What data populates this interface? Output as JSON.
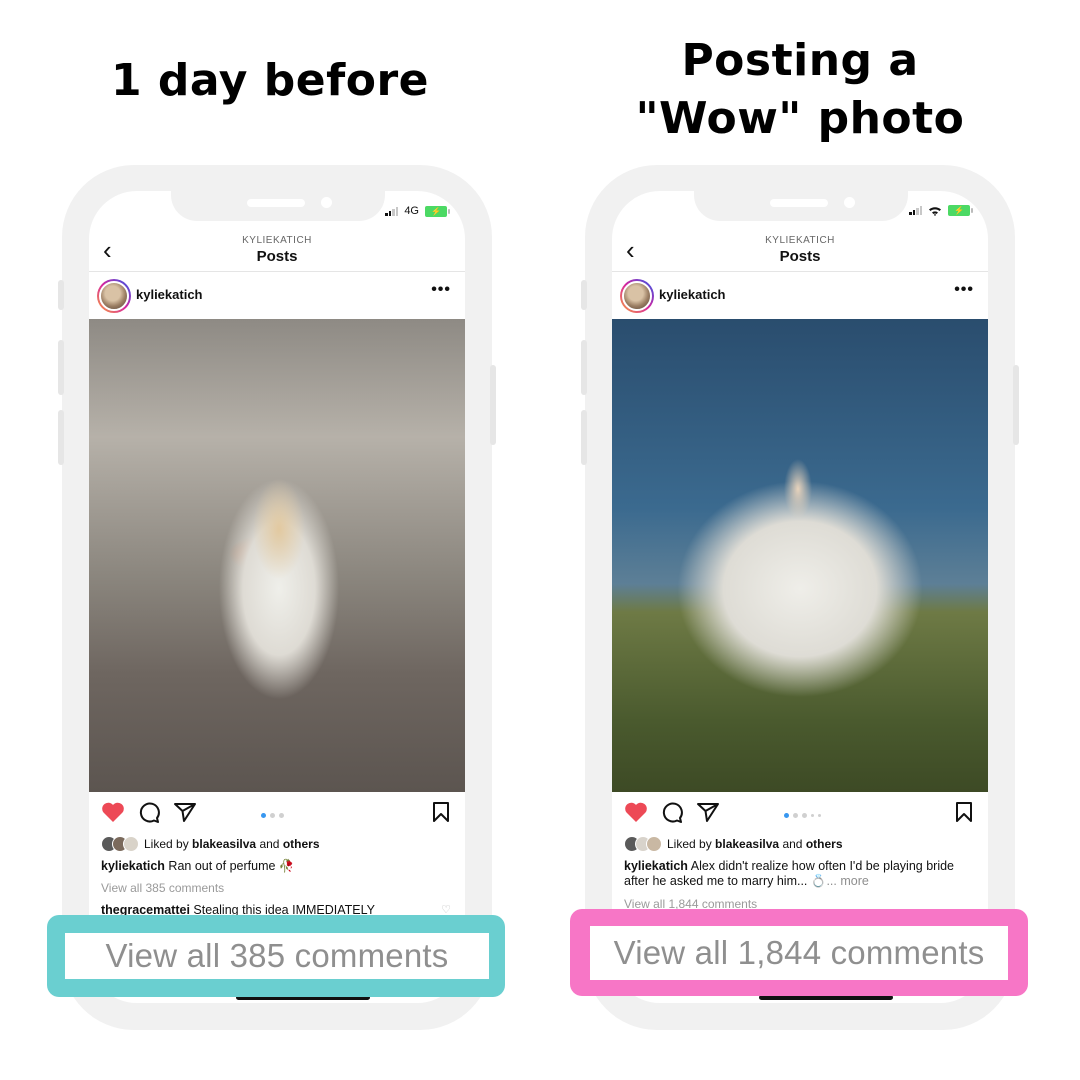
{
  "headings": {
    "left": "1 day before",
    "right_line1": "Posting a",
    "right_line2": "\"Wow\" photo"
  },
  "colors": {
    "callout_left": "#6acfd0",
    "callout_right": "#f776c6",
    "like_red": "#ed4956",
    "dot_active": "#3897f0",
    "battery_green": "#4cd964"
  },
  "phones": [
    {
      "status": {
        "network": "4G",
        "wifi": false,
        "charging": true
      },
      "nav": {
        "subtitle": "KYLIEKATICH",
        "title": "Posts",
        "back_icon": "chevron-left"
      },
      "post": {
        "username": "kyliekatich",
        "more_icon": "•••",
        "photo_alt": "Woman in white blazer holding orange roses on city street",
        "carousel": {
          "count": 3,
          "active_index": 0
        },
        "liked_by": {
          "prefix": "Liked by",
          "user": "blakeasilva",
          "middle": "and",
          "suffix": "others"
        },
        "caption": {
          "user": "kyliekatich",
          "text": "Ran out of perfume 🥀",
          "more": ""
        },
        "view_all": "View all 385 comments",
        "comment": {
          "user": "thegracemattei",
          "text": "Stealing this idea IMMEDIATELY"
        }
      },
      "callout": "View all 385 comments"
    },
    {
      "status": {
        "network": "",
        "wifi": true,
        "charging": true
      },
      "nav": {
        "subtitle": "KYLIEKATICH",
        "title": "Posts",
        "back_icon": "chevron-left"
      },
      "post": {
        "username": "kyliekatich",
        "more_icon": "•••",
        "photo_alt": "Woman in flowing white gown against blue sky, mirrored effect",
        "carousel": {
          "count": 5,
          "active_index": 0
        },
        "liked_by": {
          "prefix": "Liked by",
          "user": "blakeasilva",
          "middle": "and",
          "suffix": "others"
        },
        "caption": {
          "user": "kyliekatich",
          "text": "Alex didn't realize how often I'd be playing bride after he asked me to marry him... 💍",
          "more": "... more"
        },
        "view_all": "View all 1,844 comments",
        "comment": null
      },
      "callout": "View all 1,844 comments"
    }
  ]
}
